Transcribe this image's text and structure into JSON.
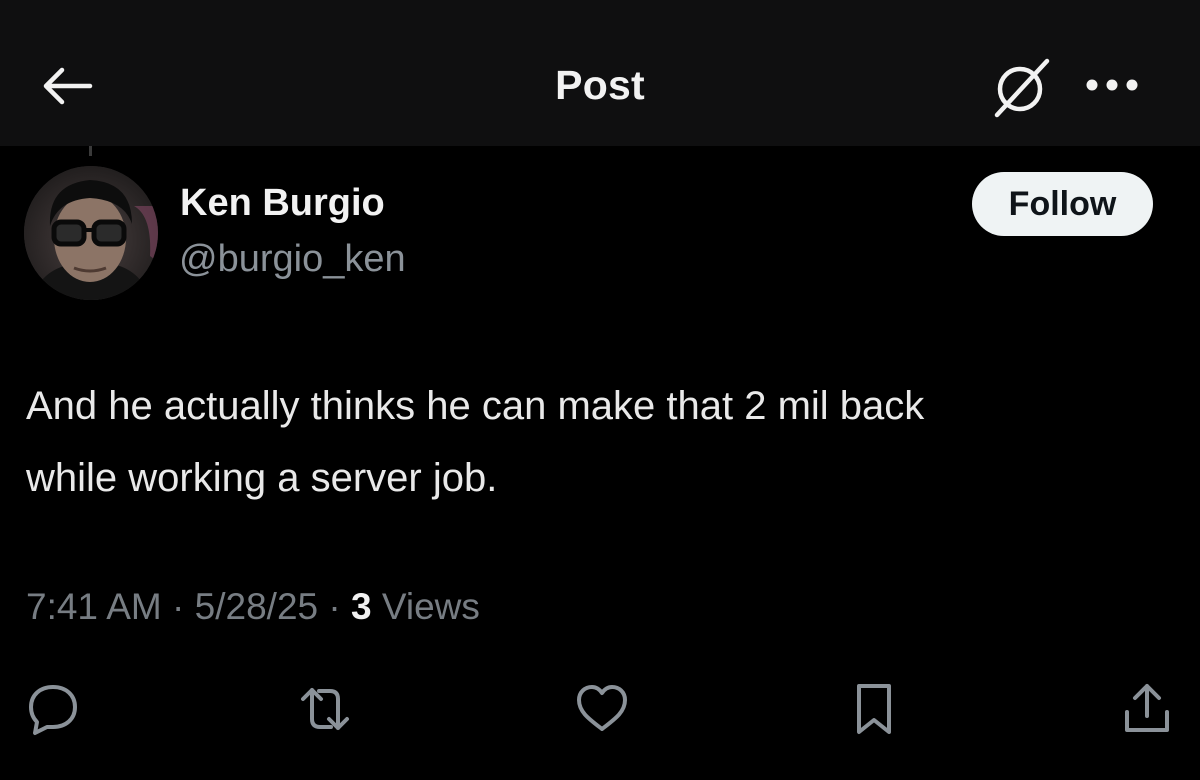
{
  "header": {
    "title": "Post",
    "back_icon": "arrow-left-icon",
    "grok_icon": "grok-slash-circle-icon",
    "more_icon": "ellipsis-icon"
  },
  "author": {
    "name": "Ken Burgio",
    "handle": "@burgio_ken",
    "follow_label": "Follow"
  },
  "post": {
    "text": "And he actually thinks he can make that 2 mil back\nwhile working a server job."
  },
  "meta": {
    "time": "7:41 AM",
    "separator": " · ",
    "date": "5/28/25",
    "views_count": "3",
    "views_label": " Views"
  },
  "actions": {
    "reply_icon": "speech-bubble-icon",
    "repost_icon": "repost-arrows-icon",
    "like_icon": "heart-icon",
    "bookmark_icon": "bookmark-icon",
    "share_icon": "share-upload-icon"
  },
  "colors": {
    "background": "#000000",
    "header_background": "#0f0f10",
    "primary_text": "#e7e9ea",
    "secondary_text": "#8b9299",
    "follow_button_bg": "#eff3f4",
    "follow_button_text": "#0f1419"
  }
}
